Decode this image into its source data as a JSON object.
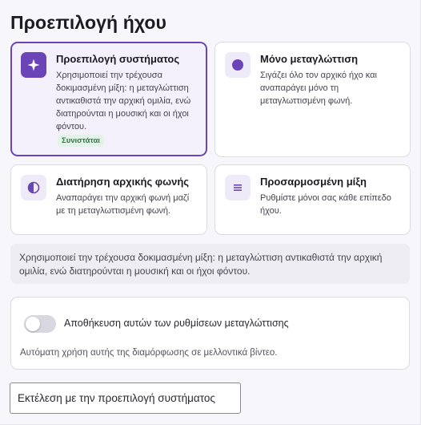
{
  "title": "Προεπιλογή ήχου",
  "options": [
    {
      "title": "Προεπιλογή συστήματος",
      "description": "Χρησιμοποιεί την τρέχουσα δοκιμασμένη μίξη: η μεταγλώττιση αντικαθιστά την αρχική ομιλία, ενώ διατηρούνται η μουσική και οι ήχοι φόντου.",
      "badge": "Συνιστάται",
      "icon": "sparkle-icon",
      "selected": true
    },
    {
      "title": "Μόνο μεταγλώττιση",
      "description": "Σιγάζει όλο τον αρχικό ήχο και αναπαράγει μόνο τη μεταγλωττισμένη φωνή.",
      "icon": "filled-circle-icon",
      "selected": false
    },
    {
      "title": "Διατήρηση αρχικής φωνής",
      "description": "Αναπαράγει την αρχική φωνή μαζί με τη μεταγλωττισμένη φωνή.",
      "icon": "half-circle-icon",
      "selected": false
    },
    {
      "title": "Προσαρμοσμένη μίξη",
      "description": "Ρυθμίστε μόνοι σας κάθε επίπεδο ήχου.",
      "icon": "sliders-icon",
      "selected": false
    }
  ],
  "info_text": "Χρησιμοποιεί την τρέχουσα δοκιμασμένη μίξη: η μεταγλώττιση αντικαθιστά την αρχική ομιλία, ενώ διατηρούνται η μουσική και οι ήχοι φόντου.",
  "save_settings": {
    "label": "Αποθήκευση αυτών των ρυθμίσεων μεταγλώττισης",
    "description": "Αυτόματη χρήση αυτής της διαμόρφωσης σε μελλοντικά βίντεο.",
    "enabled": false
  },
  "run_button": "Εκτέλεση με την προεπιλογή συστήματος",
  "colors": {
    "accent": "#6b44b8",
    "selected_bg": "#f4f0fc",
    "badge_bg": "#e4f3e7",
    "badge_text": "#2f7a44"
  }
}
